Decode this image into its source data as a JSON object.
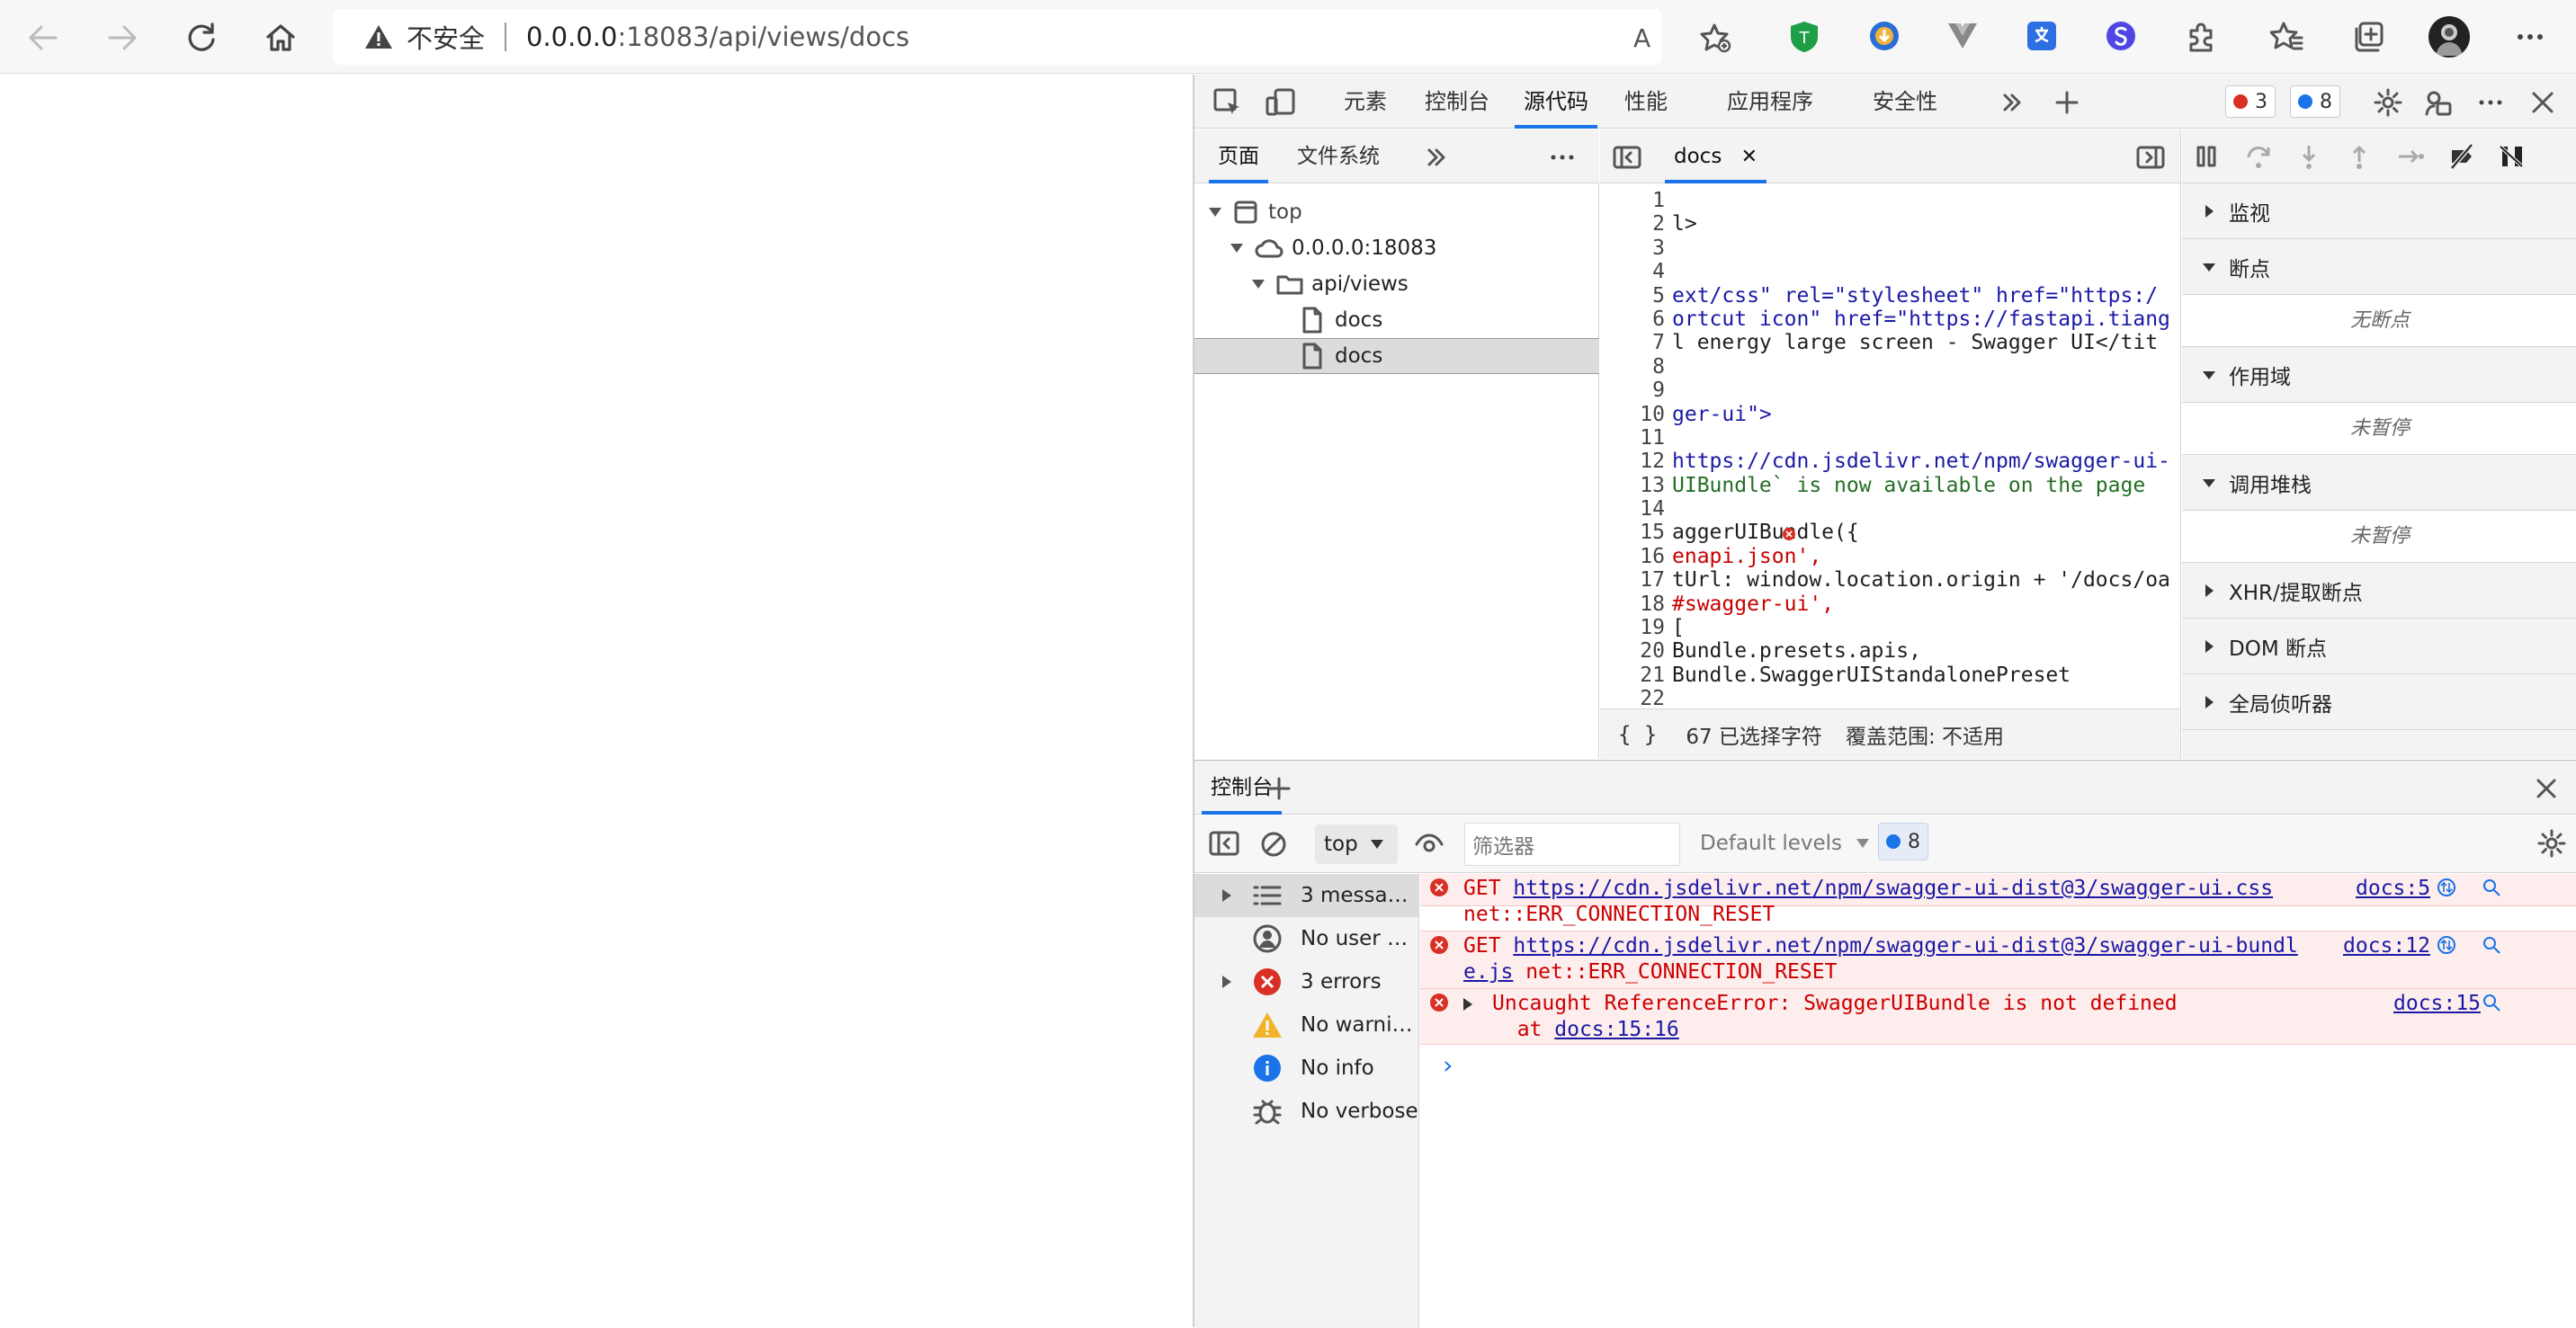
{
  "browser": {
    "insecure_label": "不安全",
    "url_host": "0.0.0.0",
    "url_rest": ":18083/api/views/docs",
    "read_aloud_label": "A"
  },
  "devtools": {
    "tabs": [
      "元素",
      "控制台",
      "源代码",
      "性能",
      "应用程序",
      "安全性"
    ],
    "active_tab": "源代码",
    "error_count": "3",
    "message_count": "8",
    "navigator": {
      "tabs": [
        "页面",
        "文件系统"
      ],
      "tree": [
        {
          "label": "top",
          "kind": "frame"
        },
        {
          "label": "0.0.0.0:18083",
          "kind": "origin"
        },
        {
          "label": "api/views",
          "kind": "folder"
        },
        {
          "label": "docs",
          "kind": "file"
        },
        {
          "label": "docs",
          "kind": "file",
          "selected": true
        }
      ]
    },
    "editor": {
      "tab_label": "docs",
      "line_numbers": [
        "1",
        "2",
        "3",
        "4",
        "5",
        "6",
        "7",
        "8",
        "9",
        "10",
        "11",
        "12",
        "13",
        "14",
        "15",
        "16",
        "17",
        "18",
        "19",
        "20",
        "21",
        "22"
      ],
      "code_lines": [
        "",
        "l>",
        "",
        "",
        "ext/css\" rel=\"stylesheet\" href=\"https:/",
        "ortcut icon\" href=\"https://fastapi.tiang",
        "l energy large screen - Swagger UI</tit",
        "",
        "",
        "ger-ui\">",
        "",
        "https://cdn.jsdelivr.net/npm/swagger-ui-",
        "UIBundle` is now available on the page",
        "",
        "aggerUIBundle({",
        "enapi.json',",
        "tUrl: window.location.origin + '/docs/oa",
        "#swagger-ui',",
        "[",
        "Bundle.presets.apis,",
        "Bundle.SwaggerUIStandalonePreset",
        ""
      ],
      "status_selected": "67 已选择字符",
      "status_coverage": "覆盖范围: 不适用",
      "pretty_print": "{ }"
    },
    "debugger": {
      "sections": [
        {
          "title": "监视",
          "expanded": false
        },
        {
          "title": "断点",
          "expanded": true,
          "body": "无断点"
        },
        {
          "title": "作用域",
          "expanded": true,
          "body": "未暂停"
        },
        {
          "title": "调用堆栈",
          "expanded": true,
          "body": "未暂停"
        },
        {
          "title": "XHR/提取断点",
          "expanded": false
        },
        {
          "title": "DOM 断点",
          "expanded": false
        },
        {
          "title": "全局侦听器",
          "expanded": false
        }
      ]
    },
    "console": {
      "drawer_tab": "控制台",
      "context": "top",
      "filter_placeholder": "筛选器",
      "levels": "Default levels",
      "issue_count": "8",
      "sidebar": [
        {
          "label": "3 messa…",
          "icon": "list-icon",
          "expandable": true
        },
        {
          "label": "No user …",
          "icon": "user-icon",
          "expandable": false
        },
        {
          "label": "3 errors",
          "icon": "error-icon",
          "expandable": true
        },
        {
          "label": "No warni…",
          "icon": "warning-icon",
          "expandable": false
        },
        {
          "label": "No info",
          "icon": "info-icon",
          "expandable": false
        },
        {
          "label": "No verbose",
          "icon": "bug-icon",
          "expandable": false
        }
      ],
      "messages": [
        {
          "method": "GET",
          "url": "https://cdn.jsdelivr.net/npm/swagger-ui-dist@3/swagger-ui.css",
          "detail": "net::ERR_CONNECTION_RESET",
          "source": "docs:5"
        },
        {
          "method": "GET",
          "url_line1": "https://cdn.jsdelivr.net/npm/swagger-ui-dist@3/swagger-ui-bundl",
          "url_line2": "e.js",
          "detail": "net::ERR_CONNECTION_RESET",
          "source": "docs:12"
        },
        {
          "text": "Uncaught ReferenceError: SwaggerUIBundle is not defined",
          "at": "at",
          "at_link": "docs:15:16",
          "source": "docs:15"
        }
      ],
      "prompt": "›"
    }
  },
  "colors": {
    "accent": "#1a73e8",
    "error": "#d93025",
    "error_bg": "#fdeded"
  }
}
